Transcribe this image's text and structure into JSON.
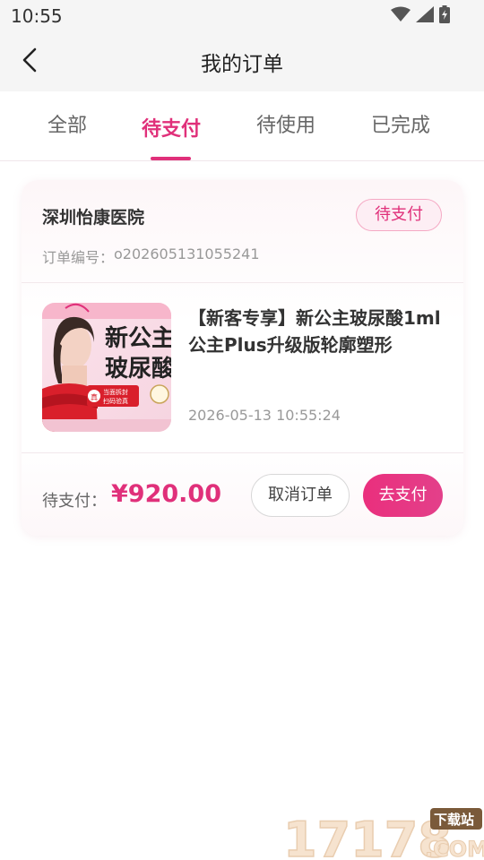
{
  "status_bar": {
    "time": "10:55",
    "icons": [
      "wifi-icon",
      "signal-icon",
      "battery-charging-icon"
    ]
  },
  "header": {
    "back_icon": "chevron-left-icon",
    "title": "我的订单"
  },
  "tabs": [
    {
      "label": "全部",
      "active": false
    },
    {
      "label": "待支付",
      "active": true
    },
    {
      "label": "待使用",
      "active": false
    },
    {
      "label": "已完成",
      "active": false
    }
  ],
  "order": {
    "hospital": "深圳怡康医院",
    "status": "待支付",
    "order_no_label": "订单编号：",
    "order_no": "o202605131055241",
    "product": {
      "title": "【新客专享】新公主玻尿酸1ml公主Plus升级版轮廓塑形",
      "image_text": {
        "line1": "新公主",
        "line2": "玻尿酸",
        "badge_line1": "当面拆封",
        "badge_line2": "扫码验真",
        "seal": "真"
      }
    },
    "created_at": "2026-05-13 10:55:24",
    "pay_label": "待支付：",
    "price": "¥920.00",
    "cancel_label": "取消订单",
    "pay_button_label": "去支付"
  },
  "watermark": {
    "text": "17178",
    "badge": "下载站",
    "suffix": ".COM"
  },
  "colors": {
    "accent": "#e0307a",
    "badge_bg": "#fdeef4",
    "page_bg": "#ffffff",
    "header_bg": "#f5f5f5"
  }
}
